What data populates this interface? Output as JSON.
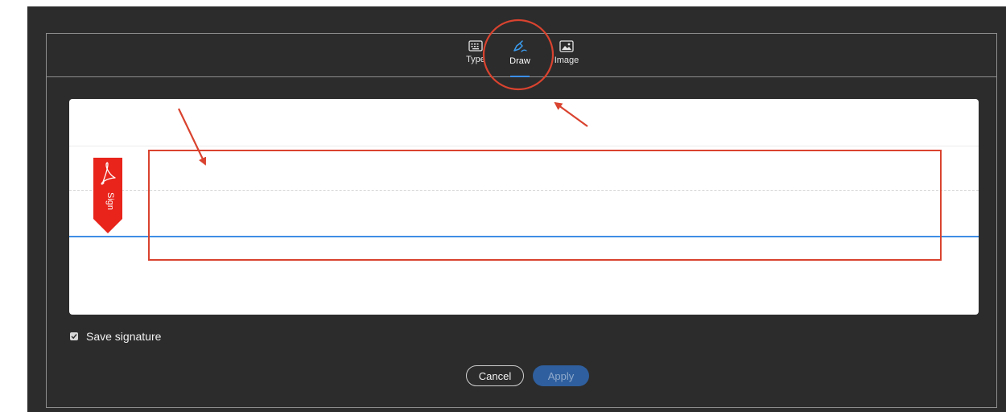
{
  "tabs": [
    {
      "label": "Type",
      "icon": "keyboard-icon",
      "active": false
    },
    {
      "label": "Draw",
      "icon": "pen-icon",
      "active": true
    },
    {
      "label": "Image",
      "icon": "image-icon",
      "active": false
    }
  ],
  "sign_flag": {
    "label": "Sign",
    "icon": "acrobat-icon",
    "color": "#e8241b"
  },
  "save_signature": {
    "label": "Save signature",
    "checked": true
  },
  "buttons": {
    "cancel": "Cancel",
    "apply": "Apply"
  },
  "colors": {
    "accent": "#3b8ff0",
    "annotation": "#d9432f",
    "apply_bg": "#2f5f9e"
  }
}
